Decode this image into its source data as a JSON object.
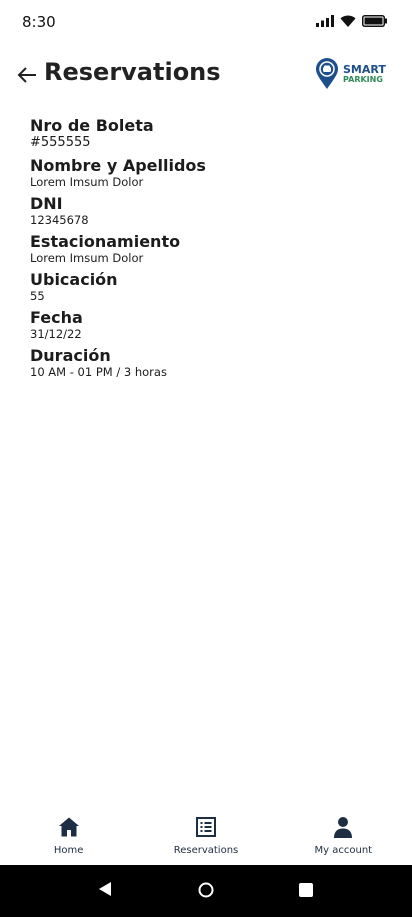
{
  "status": {
    "time": "8:30"
  },
  "header": {
    "title": "Reservations",
    "logo_line1": "SMART",
    "logo_line2": "PARKING"
  },
  "details": [
    {
      "label": "Nro de Boleta",
      "value": "#555555"
    },
    {
      "label": "Nombre y Apellidos",
      "value": "Lorem Imsum Dolor"
    },
    {
      "label": "DNI",
      "value": "12345678"
    },
    {
      "label": "Estacionamiento",
      "value": "Lorem Imsum Dolor"
    },
    {
      "label": "Ubicación",
      "value": "55"
    },
    {
      "label": "Fecha",
      "value": "31/12/22"
    },
    {
      "label": "Duración",
      "value": "10 AM - 01 PM / 3 horas"
    }
  ],
  "nav": {
    "items": [
      {
        "label": "Home",
        "icon": "home-icon"
      },
      {
        "label": "Reservations",
        "icon": "list-icon"
      },
      {
        "label": "My account",
        "icon": "account-icon"
      }
    ]
  },
  "colors": {
    "accent": "#1d4f8c",
    "nav_text": "#1d2d44",
    "logo_green": "#2f8a5a"
  }
}
